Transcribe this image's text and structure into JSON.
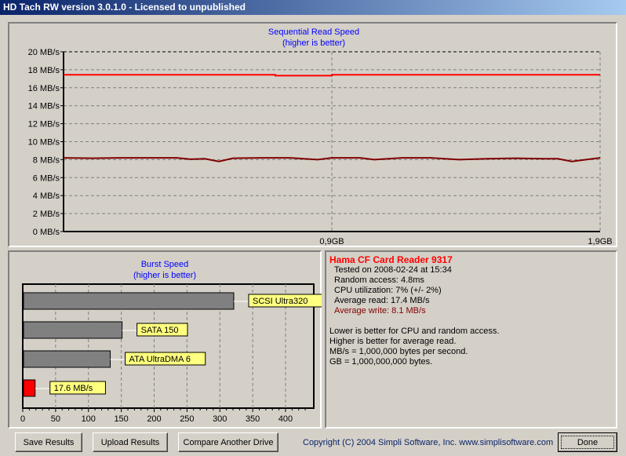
{
  "window": {
    "title": "HD Tach RW version 3.0.1.0 - Licensed to unpublished"
  },
  "read_chart": {
    "title": "Sequential Read Speed",
    "subtitle": "(higher is better)"
  },
  "burst_chart": {
    "title": "Burst Speed",
    "subtitle": "(higher is better)"
  },
  "info": {
    "drive": "Hama CF Card Reader 9317",
    "tested": "Tested on 2008-02-24 at 15:34",
    "random_access": "Random access: 4.8ms",
    "cpu": "CPU utilization: 7% (+/- 2%)",
    "avg_read": "Average read: 17.4 MB/s",
    "avg_write": "Average write: 8.1 MB/s",
    "notes": [
      "Lower is better for CPU and random access.",
      "Higher is better for average read.",
      "MB/s = 1,000,000 bytes per second.",
      "GB = 1,000,000,000 bytes."
    ]
  },
  "buttons": {
    "save": "Save Results",
    "upload": "Upload Results",
    "compare": "Compare Another Drive",
    "done": "Done"
  },
  "copyright": "Copyright (C) 2004 Simpli Software, Inc. www.simplisoftware.com",
  "colors": {
    "read": "#ff0000",
    "write": "#800000",
    "link": "#0000ff"
  },
  "chart_data": [
    {
      "type": "line",
      "title": "Sequential Read Speed",
      "subtitle": "(higher is better)",
      "ylim": [
        0,
        20
      ],
      "yticks": [
        "0 MB/s",
        "2 MB/s",
        "4 MB/s",
        "6 MB/s",
        "8 MB/s",
        "10 MB/s",
        "12 MB/s",
        "14 MB/s",
        "16 MB/s",
        "18 MB/s",
        "20 MB/s"
      ],
      "xlim": [
        0,
        1.9
      ],
      "xticks": [
        {
          "v": 0.95,
          "label": "0,9GB"
        },
        {
          "v": 1.9,
          "label": "1,9GB"
        }
      ],
      "series": [
        {
          "name": "Read",
          "x": [
            0,
            0.25,
            0.5,
            0.75,
            0.75,
            0.95,
            0.95,
            1.2,
            1.5,
            1.9
          ],
          "y": [
            17.45,
            17.45,
            17.45,
            17.45,
            17.35,
            17.35,
            17.45,
            17.45,
            17.45,
            17.45
          ]
        },
        {
          "name": "Write",
          "x": [
            0,
            0.1,
            0.2,
            0.3,
            0.4,
            0.45,
            0.5,
            0.55,
            0.6,
            0.7,
            0.8,
            0.9,
            0.95,
            1.0,
            1.05,
            1.1,
            1.2,
            1.3,
            1.4,
            1.5,
            1.6,
            1.7,
            1.75,
            1.8,
            1.85,
            1.9
          ],
          "y": [
            8.2,
            8.15,
            8.2,
            8.2,
            8.2,
            8.05,
            8.1,
            7.8,
            8.15,
            8.2,
            8.2,
            8.0,
            8.2,
            8.2,
            8.2,
            8.0,
            8.2,
            8.2,
            8.0,
            8.1,
            8.15,
            8.1,
            8.1,
            7.8,
            8.0,
            8.2
          ]
        }
      ]
    },
    {
      "type": "bar",
      "title": "Burst Speed",
      "subtitle": "(higher is better)",
      "xlim": [
        0,
        440
      ],
      "xticks": [
        0,
        50,
        100,
        150,
        200,
        250,
        300,
        350,
        400
      ],
      "bars": [
        {
          "label": "SCSI Ultra320",
          "value": 320,
          "color": "#808080"
        },
        {
          "label": "SATA 150",
          "value": 150,
          "color": "#808080"
        },
        {
          "label": "ATA UltraDMA 6",
          "value": 132,
          "color": "#808080"
        },
        {
          "label": "17.6 MB/s",
          "value": 17.6,
          "color": "#ff0000"
        }
      ]
    }
  ]
}
